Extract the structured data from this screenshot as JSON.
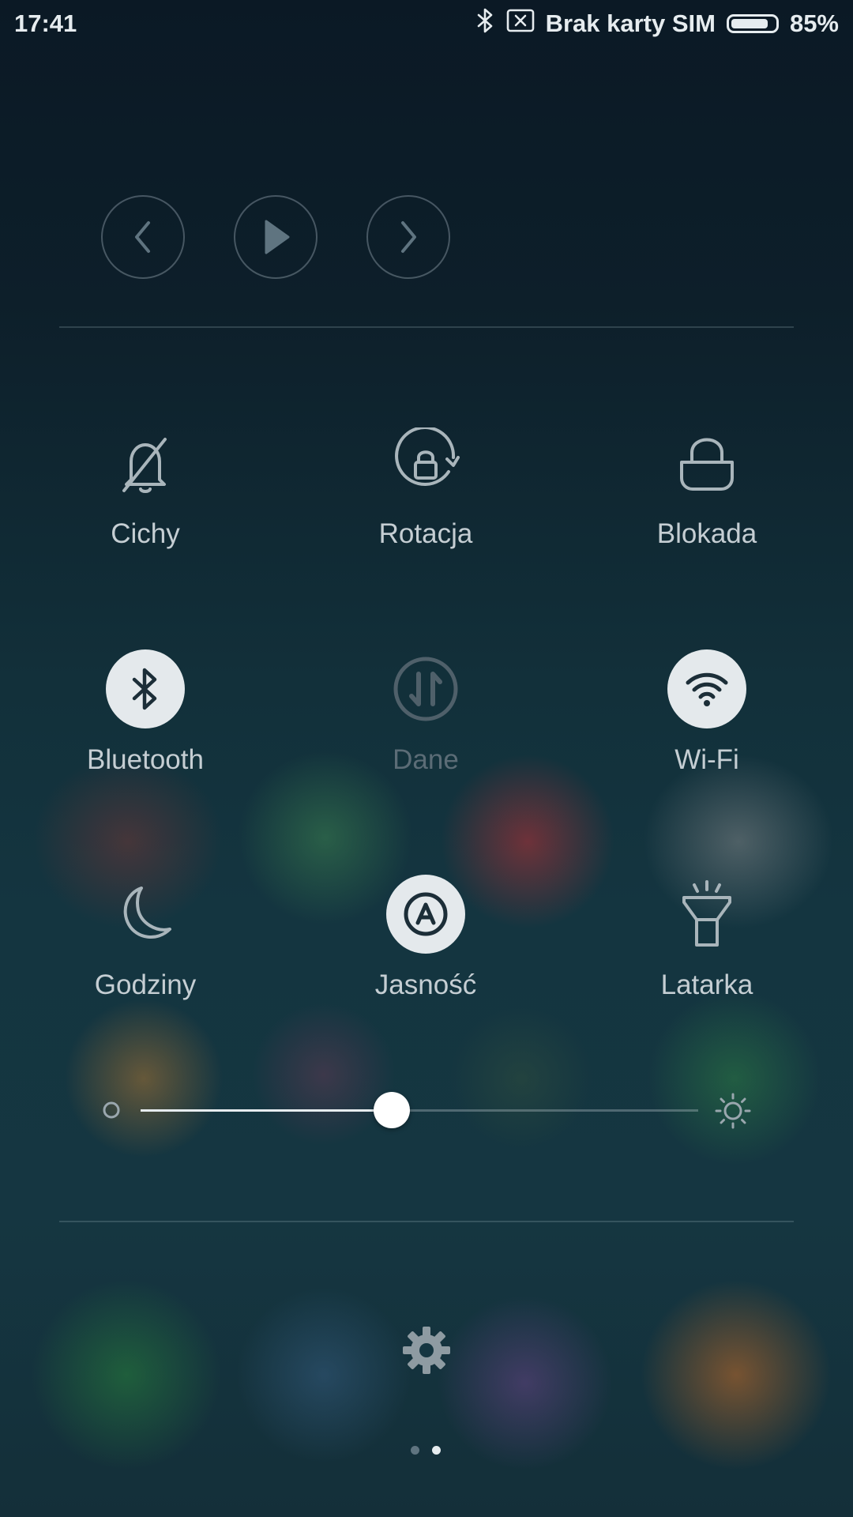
{
  "status_bar": {
    "time": "17:41",
    "sim_text": "Brak karty SIM",
    "battery_percent": "85%",
    "battery_level": 0.85
  },
  "media": {
    "buttons": [
      "previous",
      "play",
      "next"
    ]
  },
  "toggles": [
    {
      "label": "Cichy",
      "icon": "bell-off-icon",
      "state": "off"
    },
    {
      "label": "Rotacja",
      "icon": "rotation-lock-icon",
      "state": "off"
    },
    {
      "label": "Blokada",
      "icon": "lock-icon",
      "state": "off"
    },
    {
      "label": "Bluetooth",
      "icon": "bluetooth-icon",
      "state": "on"
    },
    {
      "label": "Dane",
      "icon": "mobile-data-icon",
      "state": "disabled"
    },
    {
      "label": "Wi-Fi",
      "icon": "wifi-icon",
      "state": "on"
    },
    {
      "label": "Godziny",
      "icon": "moon-icon",
      "state": "off"
    },
    {
      "label": "Jasność",
      "icon": "auto-brightness-icon",
      "state": "on"
    },
    {
      "label": "Latarka",
      "icon": "flashlight-icon",
      "state": "off"
    }
  ],
  "brightness": {
    "level": 0.45
  },
  "pager": {
    "pages": 2,
    "current": 2
  },
  "colors": {
    "active_tile": "#e4e9ec",
    "label": "#c5ced3",
    "disabled_label": "#5b6c76"
  }
}
